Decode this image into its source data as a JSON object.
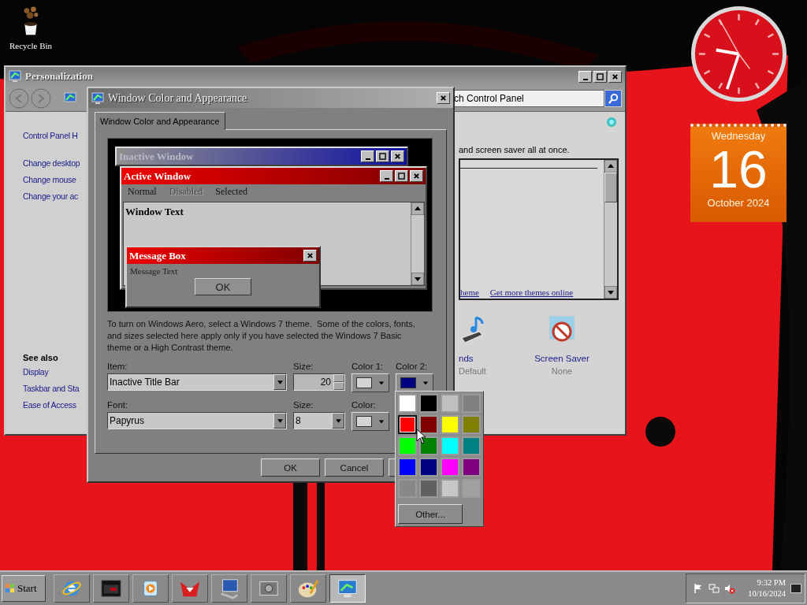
{
  "desktop": {
    "icons": [
      {
        "label": "Recycle Bin"
      }
    ]
  },
  "personalization": {
    "title": "Personalization",
    "search": {
      "placeholder": "ch Control Panel"
    },
    "sidebar": {
      "home": "Control Panel H",
      "links": [
        "Change desktop",
        "Change mouse",
        "Change your ac"
      ],
      "see_also_title": "See also",
      "see_also": [
        "Display",
        "Taskbar and Sta",
        "Ease of Access"
      ]
    },
    "description": "and screen saver all at once.",
    "theme_links": [
      "heme",
      "Get more themes online"
    ],
    "settings": [
      {
        "kind": "sounds",
        "label": "nds",
        "value": "Default"
      },
      {
        "kind": "screensaver",
        "label": "Screen Saver",
        "value": "None"
      }
    ]
  },
  "dialog": {
    "title": "Window Color and Appearance",
    "tabs": [
      {
        "label": "Window Color and Appearance",
        "selected": true
      }
    ],
    "preview": {
      "inactive_title": "Inactive Window",
      "active_title": "Active Window",
      "menu": [
        {
          "label": "Normal",
          "disabled": false
        },
        {
          "label": "Disabled",
          "disabled": true
        },
        {
          "label": "Selected",
          "disabled": false
        }
      ],
      "window_text": "Window Text",
      "message_box": {
        "title": "Message Box",
        "text": "Message Text",
        "button": "OK"
      }
    },
    "note": "To turn on Windows Aero, select a Windows 7 theme.  Some of the colors, fonts, and sizes selected here apply only if you have selected the Windows 7 Basic theme or a High Contrast theme.",
    "item": {
      "label": "Item:",
      "value": "Inactive Title Bar"
    },
    "item_size": {
      "label": "Size:",
      "value": "20"
    },
    "color1": {
      "label": "Color 1:",
      "color": "#d4d4d4"
    },
    "color2": {
      "label": "Color 2:",
      "color": "#000080"
    },
    "font": {
      "label": "Font:",
      "value": "Papyrus"
    },
    "font_size": {
      "label": "Size:",
      "value": "8"
    },
    "font_color": {
      "label": "Color:",
      "color": "#d4d4d4"
    },
    "buttons": [
      "OK",
      "Cancel"
    ],
    "palette": {
      "swatches": [
        {
          "color": "#ffffff",
          "selected": false
        },
        {
          "color": "#000000",
          "selected": false
        },
        {
          "color": "#c0c0c0",
          "selected": false
        },
        {
          "color": "#808080",
          "selected": false
        },
        {
          "color": "#ff0000",
          "selected": true
        },
        {
          "color": "#800000",
          "selected": false
        },
        {
          "color": "#ffff00",
          "selected": false
        },
        {
          "color": "#808000",
          "selected": false
        },
        {
          "color": "#00ff00",
          "selected": false
        },
        {
          "color": "#008000",
          "selected": false
        },
        {
          "color": "#00ffff",
          "selected": false
        },
        {
          "color": "#008080",
          "selected": false
        },
        {
          "color": "#0000ff",
          "selected": false
        },
        {
          "color": "#000080",
          "selected": false
        },
        {
          "color": "#ff00ff",
          "selected": false
        },
        {
          "color": "#800080",
          "selected": false
        },
        {
          "color": "#888888",
          "selected": false
        },
        {
          "color": "#606060",
          "selected": false
        },
        {
          "color": "#c8c8c8",
          "selected": false
        },
        {
          "color": "#a0a0a0",
          "selected": false
        }
      ],
      "other": "Other..."
    }
  },
  "calendar": {
    "weekday": "Wednesday",
    "day": "16",
    "month": "October 2024"
  },
  "taskbar": {
    "start": "Start",
    "apps": [
      {
        "kind": "browser",
        "selected": false
      },
      {
        "kind": "folder",
        "selected": false
      },
      {
        "kind": "media",
        "selected": false
      },
      {
        "kind": "fox",
        "selected": false
      },
      {
        "kind": "computer",
        "selected": false
      },
      {
        "kind": "drive",
        "selected": false
      },
      {
        "kind": "palette",
        "selected": false
      },
      {
        "kind": "display",
        "selected": true
      }
    ],
    "time": "9:32 PM",
    "date": "10/16/2024"
  }
}
